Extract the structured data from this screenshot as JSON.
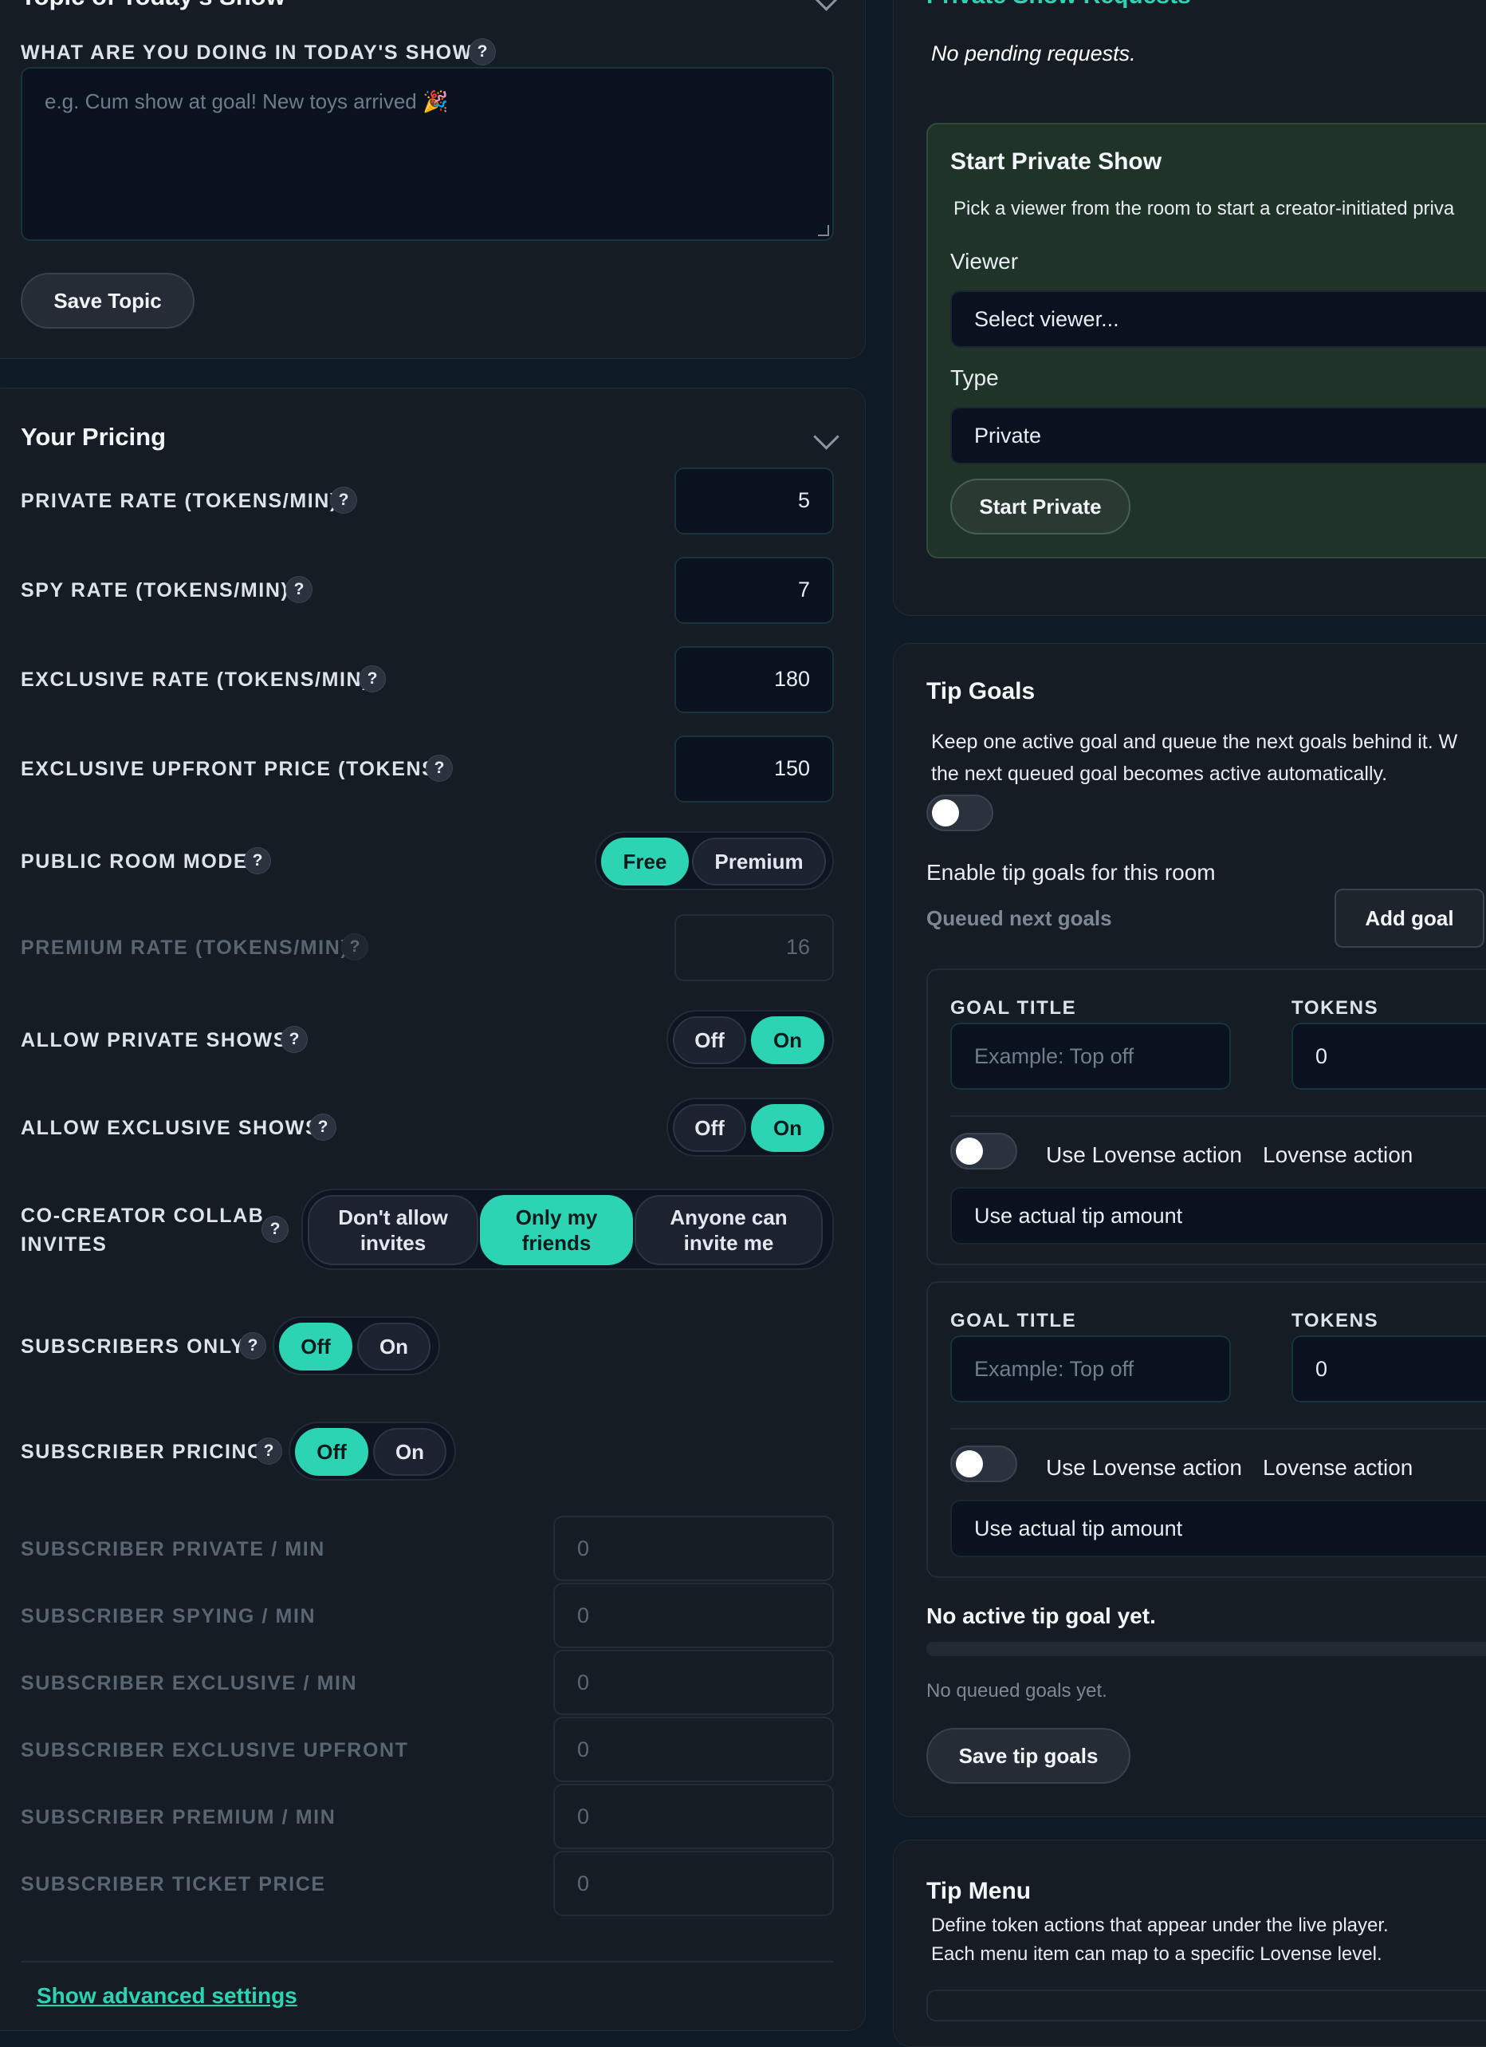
{
  "left": {
    "topic": {
      "title": "Topic of Today's Show",
      "question": "WHAT ARE YOU DOING IN TODAY'S SHOW?",
      "placeholder": "e.g. Cum show at goal! New toys arrived 🎉",
      "save_label": "Save Topic"
    },
    "pricing": {
      "title": "Your Pricing",
      "private_rate_label": "PRIVATE RATE (TOKENS/MIN)",
      "private_rate": "5",
      "spy_rate_label": "SPY RATE (TOKENS/MIN)",
      "spy_rate": "7",
      "exclusive_rate_label": "EXCLUSIVE RATE (TOKENS/MIN)",
      "exclusive_rate": "180",
      "exclusive_upfront_label": "EXCLUSIVE UPFRONT PRICE (TOKENS)",
      "exclusive_upfront": "150",
      "public_room_mode_label": "PUBLIC ROOM MODE",
      "mode_free": "Free",
      "mode_premium": "Premium",
      "premium_rate_label": "PREMIUM RATE (TOKENS/MIN)",
      "premium_rate": "16",
      "allow_private_label": "ALLOW PRIVATE SHOWS",
      "allow_exclusive_label": "ALLOW EXCLUSIVE SHOWS",
      "off": "Off",
      "on": "On",
      "collab_label_1": "CO-CREATOR COLLAB",
      "collab_label_2": "INVITES",
      "collab_opt1_1": "Don't allow",
      "collab_opt1_2": "invites",
      "collab_opt2_1": "Only my",
      "collab_opt2_2": "friends",
      "collab_opt3_1": "Anyone can",
      "collab_opt3_2": "invite me",
      "subscribers_only_label": "SUBSCRIBERS ONLY",
      "subscriber_pricing_label": "SUBSCRIBER PRICING",
      "sub_private_label": "SUBSCRIBER PRIVATE / MIN",
      "sub_private": "0",
      "sub_spying_label": "SUBSCRIBER SPYING / MIN",
      "sub_spying": "0",
      "sub_exclusive_label": "SUBSCRIBER EXCLUSIVE / MIN",
      "sub_exclusive": "0",
      "sub_upfront_label": "SUBSCRIBER EXCLUSIVE UPFRONT",
      "sub_upfront": "0",
      "sub_premium_label": "SUBSCRIBER PREMIUM / MIN",
      "sub_premium": "0",
      "sub_ticket_label": "SUBSCRIBER TICKET PRICE",
      "sub_ticket": "0",
      "advanced_link": "Show advanced settings"
    }
  },
  "right": {
    "requests": {
      "title": "Private Show Requests",
      "empty": "No pending requests."
    },
    "start_private": {
      "title": "Start Private Show",
      "description": "Pick a viewer from the room to start a creator-initiated priva",
      "viewer_label": "Viewer",
      "viewer_value": "Select viewer...",
      "type_label": "Type",
      "type_value": "Private",
      "button": "Start Private"
    },
    "tip_goals": {
      "title": "Tip Goals",
      "description_1": "Keep one active goal and queue the next goals behind it. W",
      "description_2": "the next queued goal becomes active automatically.",
      "enable_label": "Enable tip goals for this room",
      "queued_label": "Queued next goals",
      "add_goal": "Add goal",
      "goals": [
        {
          "title_label": "GOAL TITLE",
          "title_placeholder": "Example: Top off",
          "tokens_label": "TOKENS",
          "tokens_value": "0",
          "lovense_toggle_label": "Use Lovense action",
          "lovense_label": "Lovense action",
          "amount_value": "Use actual tip amount"
        },
        {
          "title_label": "GOAL TITLE",
          "title_placeholder": "Example: Top off",
          "tokens_label": "TOKENS",
          "tokens_value": "0",
          "lovense_toggle_label": "Use Lovense action",
          "lovense_label": "Lovense action",
          "amount_value": "Use actual tip amount"
        }
      ],
      "no_active": "No active tip goal yet.",
      "no_queued": "No queued goals yet.",
      "save": "Save tip goals"
    },
    "tip_menu": {
      "title": "Tip Menu",
      "description_1": "Define token actions that appear under the live player.",
      "description_2": "Each menu item can map to a specific Lovense level."
    }
  },
  "colors": {
    "accent": "#2dd4b4",
    "background": "#0f1a27",
    "panel": "#161c24",
    "green_card": "#1f3328"
  }
}
